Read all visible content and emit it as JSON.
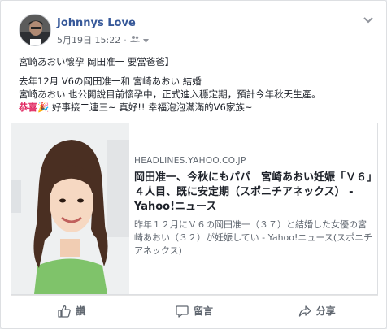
{
  "post": {
    "author": "Johnnys Love",
    "timestamp": "5月19日 15:22",
    "audience_icon": "friends-icon",
    "more_icon": "chevron-down-icon",
    "lines": [
      "宮崎あおい懷孕 岡田准一 要當爸爸】",
      "去年12月 V6の岡田准一和 宮崎あおい 結婚",
      "宮崎あおい 也公開說目前懷孕中，正式進入穩定期，預計今年秋天生產。",
      "好事接二連三~ 真好!! 幸福泡泡滿滿的V6家族~"
    ],
    "congrats_label": "恭喜",
    "congrats_emoji": "🎉"
  },
  "link_preview": {
    "domain": "HEADLINES.YAHOO.CO.JP",
    "title": "岡田准一、今秋にもパパ　宮崎あおい妊娠「Ｖ６」４人目、既に安定期（スポニチアネックス） - Yahoo!ニュース",
    "description": "昨年１２月にＶ６の岡田准一（３７）と結婚した女優の宮崎あおい（３２）が妊娠してい - Yahoo!ニュース(スポニチアネックス)"
  },
  "actions": {
    "like": "讚",
    "comment": "留言",
    "share": "分享"
  },
  "colors": {
    "author_link": "#365899",
    "congrats": "#e0245e",
    "secondary_text": "#606770"
  }
}
